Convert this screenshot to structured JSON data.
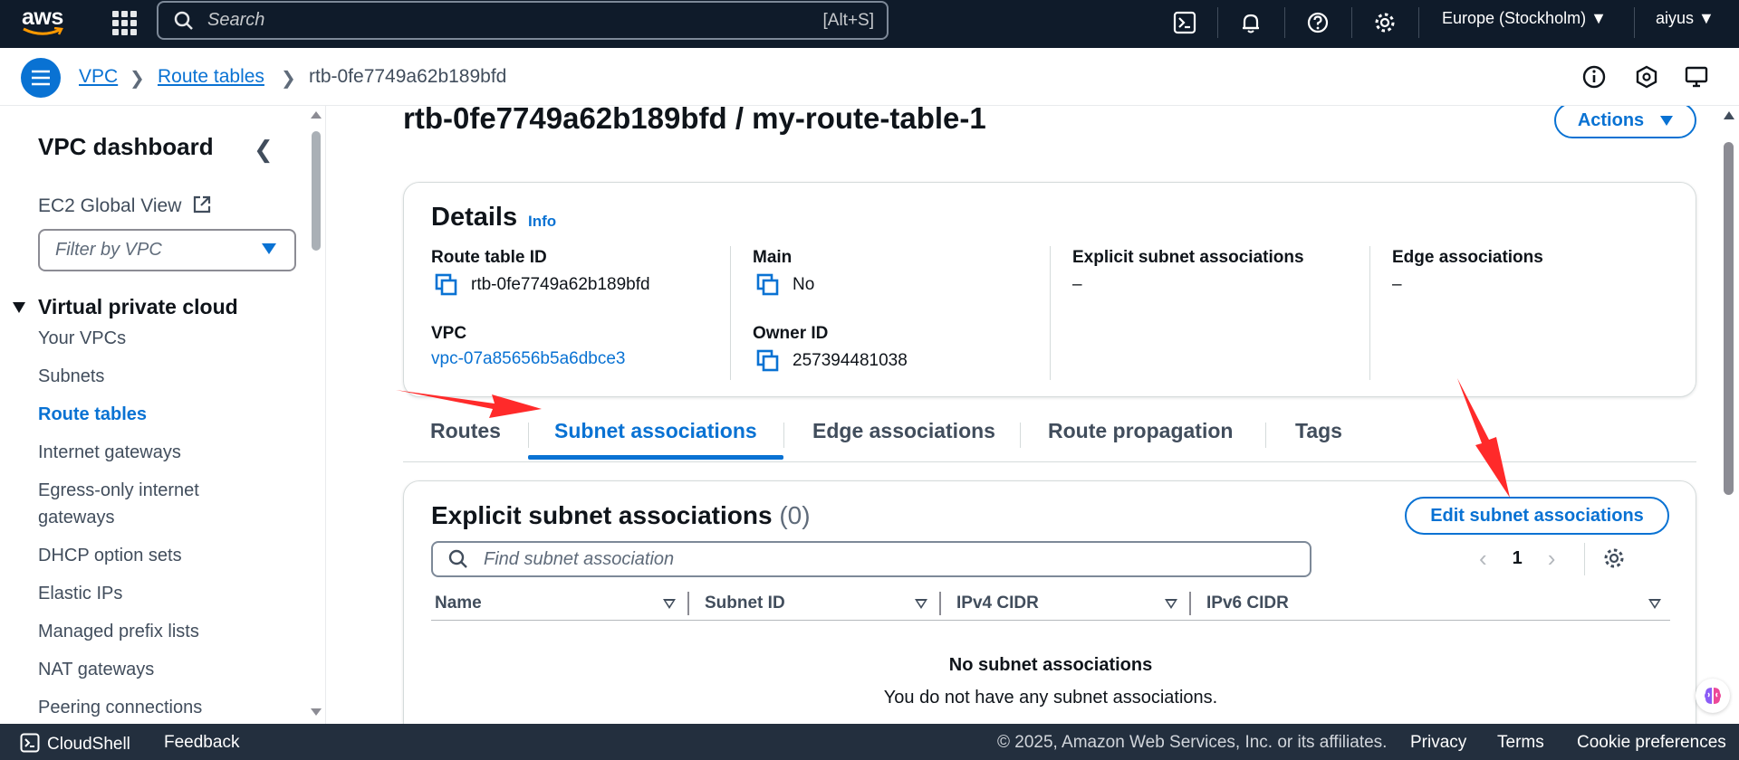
{
  "topnav": {
    "logo_text": "aws",
    "search_placeholder": "Search",
    "search_shortcut": "[Alt+S]",
    "icons": [
      "cloudshell-icon",
      "bell-icon",
      "help-icon",
      "gear-icon"
    ],
    "region": "Europe (Stockholm)",
    "user": "aiyus"
  },
  "breadcrumb": {
    "items": [
      "VPC",
      "Route tables",
      "rtb-0fe7749a62b189bfd"
    ]
  },
  "sidebar": {
    "title": "VPC dashboard",
    "ec2_global_view": "EC2 Global View",
    "filter_placeholder": "Filter by VPC",
    "section": "Virtual private cloud",
    "items": [
      {
        "label": "Your VPCs"
      },
      {
        "label": "Subnets"
      },
      {
        "label": "Route tables",
        "active": true
      },
      {
        "label": "Internet gateways"
      },
      {
        "label": "Egress-only internet gateways"
      },
      {
        "label": "DHCP option sets"
      },
      {
        "label": "Elastic IPs"
      },
      {
        "label": "Managed prefix lists"
      },
      {
        "label": "NAT gateways"
      },
      {
        "label": "Peering connections"
      }
    ]
  },
  "page": {
    "title": "rtb-0fe7749a62b189bfd / my-route-table-1",
    "actions_label": "Actions"
  },
  "details": {
    "title": "Details",
    "info": "Info",
    "route_table_id_label": "Route table ID",
    "route_table_id": "rtb-0fe7749a62b189bfd",
    "vpc_label": "VPC",
    "vpc": "vpc-07a85656b5a6dbce3",
    "main_label": "Main",
    "main": "No",
    "owner_id_label": "Owner ID",
    "owner_id": "257394481038",
    "explicit_label": "Explicit subnet associations",
    "explicit": "–",
    "edge_label": "Edge associations",
    "edge": "–"
  },
  "tabs": [
    "Routes",
    "Subnet associations",
    "Edge associations",
    "Route propagation",
    "Tags"
  ],
  "active_tab": "Subnet associations",
  "subnet_panel": {
    "title": "Explicit subnet associations",
    "count": "(0)",
    "edit_label": "Edit subnet associations",
    "find_placeholder": "Find subnet association",
    "page": "1",
    "columns": [
      "Name",
      "Subnet ID",
      "IPv4 CIDR",
      "IPv6 CIDR"
    ],
    "empty_title": "No subnet associations",
    "empty_text": "You do not have any subnet associations."
  },
  "footer": {
    "cloudshell": "CloudShell",
    "feedback": "Feedback",
    "copyright": "© 2025, Amazon Web Services, Inc. or its affiliates.",
    "privacy": "Privacy",
    "terms": "Terms",
    "cookies": "Cookie preferences"
  },
  "colors": {
    "nav_bg": "#0f1b2a",
    "link": "#0972d3",
    "footer_bg": "#232f3e",
    "annotation": "#ff2a2a"
  }
}
